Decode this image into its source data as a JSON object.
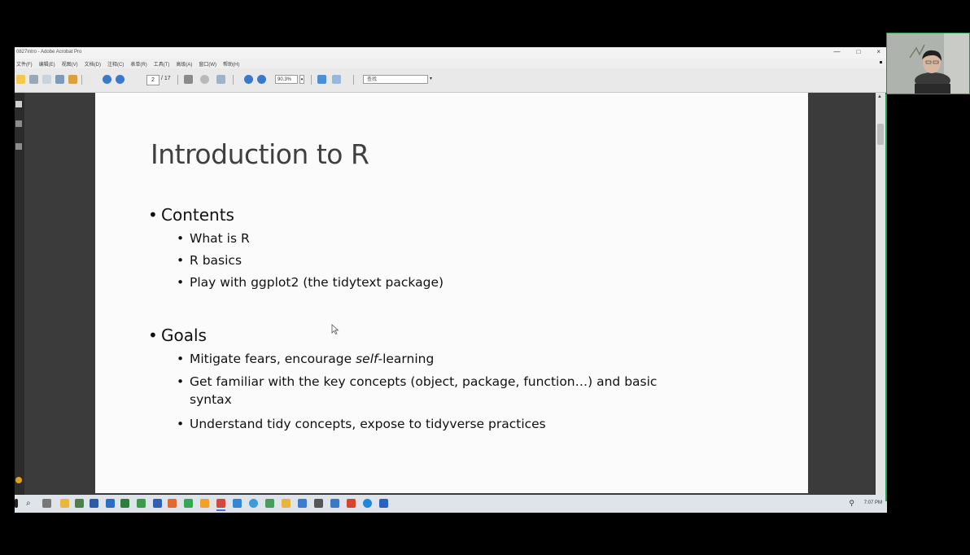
{
  "window": {
    "title": "0827intro - Adobe Acrobat Pro",
    "controls": [
      "—",
      "□",
      "×"
    ]
  },
  "menubar": {
    "items": [
      "文件(F)",
      "编辑(E)",
      "视图(V)",
      "文档(D)",
      "注释(C)",
      "表单(R)",
      "工具(T)",
      "高级(A)",
      "窗口(W)",
      "帮助(H)"
    ]
  },
  "toolbar": {
    "page_current": "2",
    "page_total": "/ 17",
    "zoom": "90.3%",
    "zoom_arrow": "▾",
    "find_placeholder": "查找",
    "find_arrow": "▾"
  },
  "slide": {
    "title": "Introduction to R",
    "sections": [
      {
        "heading": "Contents",
        "items": [
          "What is R",
          "R basics",
          "Play with ggplot2 (the tidytext package)"
        ]
      },
      {
        "heading": "Goals",
        "items": [
          "Mitigate fears, encourage ",
          "self",
          "-learning",
          "Get familiar with the key concepts (object, package, function…) and basic syntax",
          "Understand tidy concepts, expose to tidyverse practices"
        ]
      }
    ],
    "bullet": "•"
  },
  "taskbar": {
    "time": "7:07 PM"
  },
  "colors": {
    "slide_bg": "#fbfbfb",
    "desktop_bg": "#3b3b3b",
    "webcam_border": "#2d8c4b",
    "taskbar_bg": "#dfe4ea"
  }
}
